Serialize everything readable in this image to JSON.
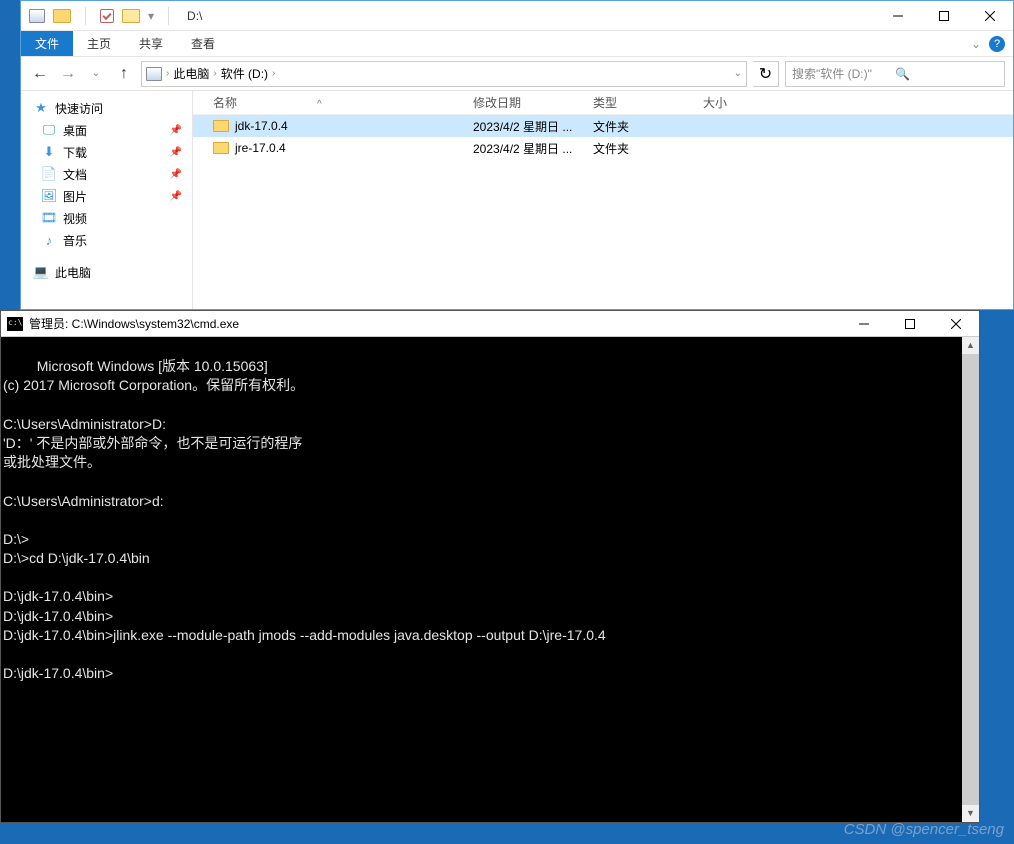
{
  "explorer": {
    "title": "D:\\",
    "tabs": {
      "file": "文件",
      "home": "主页",
      "share": "共享",
      "view": "查看"
    },
    "breadcrumb": {
      "pc": "此电脑",
      "drive": "软件 (D:)"
    },
    "search_placeholder": "搜索\"软件 (D:)\"",
    "columns": {
      "name": "名称",
      "date": "修改日期",
      "type": "类型",
      "size": "大小"
    },
    "sidebar": {
      "quick": "快速访问",
      "desktop": "桌面",
      "downloads": "下载",
      "documents": "文档",
      "pictures": "图片",
      "videos": "视频",
      "music": "音乐",
      "thispc": "此电脑"
    },
    "items": [
      {
        "name": "jdk-17.0.4",
        "date": "2023/4/2 星期日 ...",
        "type": "文件夹",
        "selected": true
      },
      {
        "name": "jre-17.0.4",
        "date": "2023/4/2 星期日 ...",
        "type": "文件夹",
        "selected": false
      }
    ]
  },
  "cmd": {
    "title": "管理员: C:\\Windows\\system32\\cmd.exe",
    "lines": "Microsoft Windows [版本 10.0.15063]\n(c) 2017 Microsoft Corporation。保留所有权利。\n\nC:\\Users\\Administrator>D:\n'D：' 不是内部或外部命令，也不是可运行的程序\n或批处理文件。\n\nC:\\Users\\Administrator>d:\n\nD:\\>\nD:\\>cd D:\\jdk-17.0.4\\bin\n\nD:\\jdk-17.0.4\\bin>\nD:\\jdk-17.0.4\\bin>\nD:\\jdk-17.0.4\\bin>jlink.exe --module-path jmods --add-modules java.desktop --output D:\\jre-17.0.4\n\nD:\\jdk-17.0.4\\bin>"
  },
  "watermark": "CSDN @spencer_tseng"
}
